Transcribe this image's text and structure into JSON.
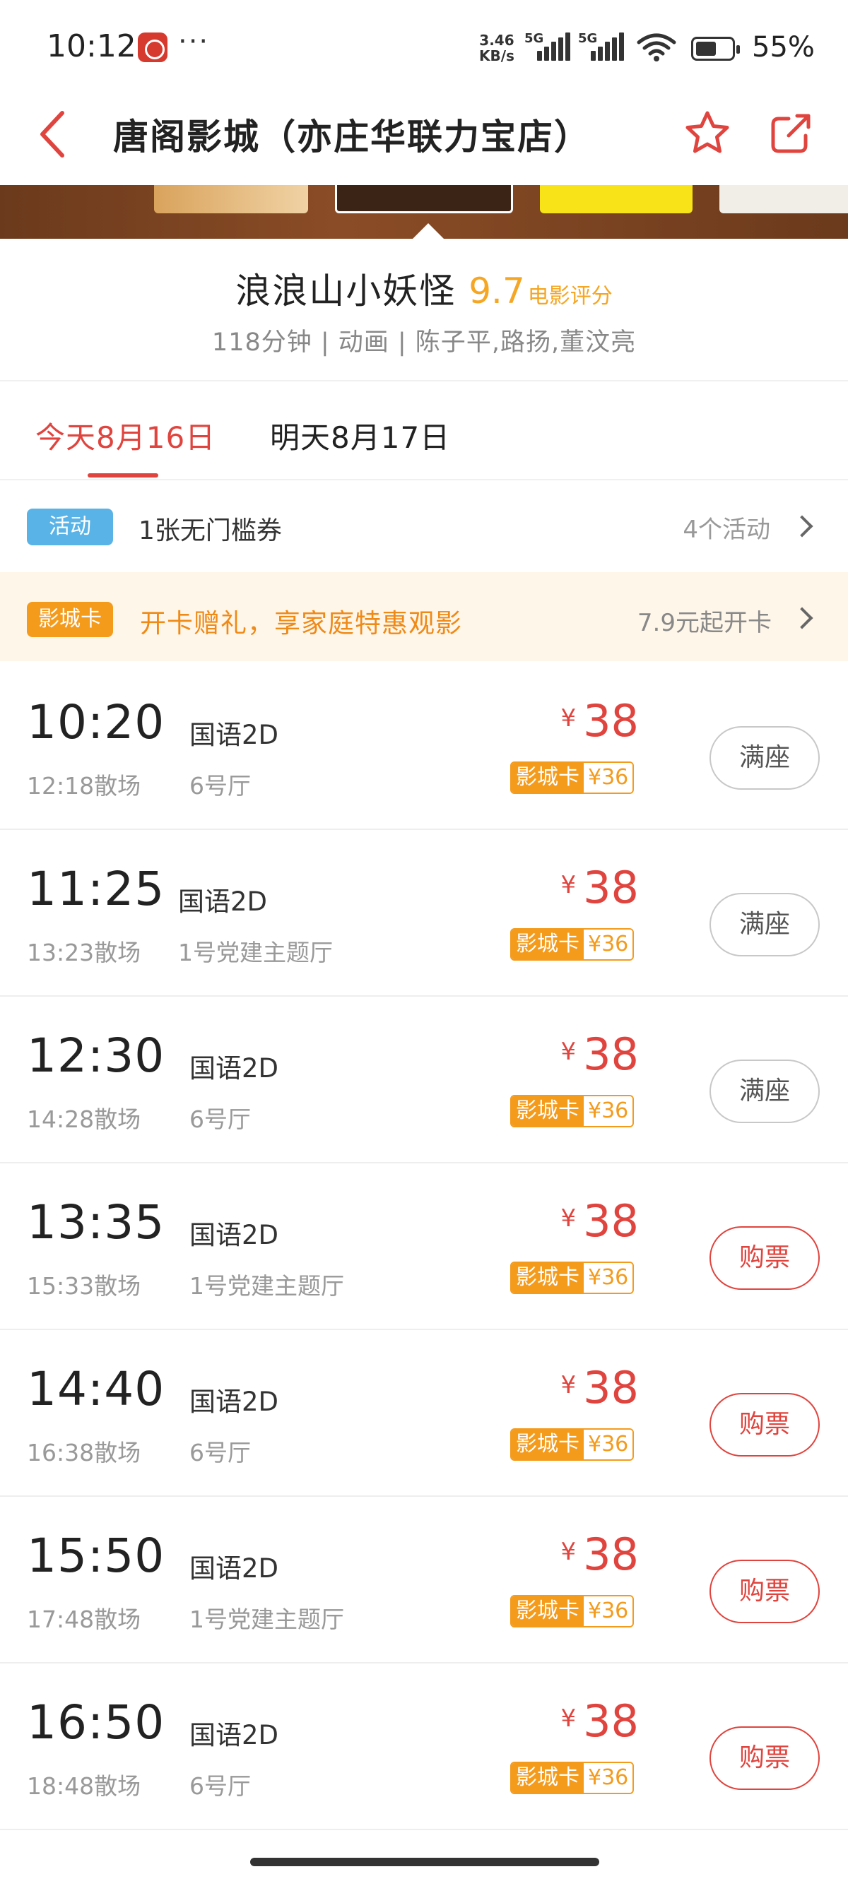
{
  "status_bar": {
    "time": "10:12",
    "dots": "···",
    "net_speed_value": "3.46",
    "net_speed_unit": "KB/s",
    "network_1": "5G",
    "network_2": "5G",
    "battery": "55%"
  },
  "header": {
    "title": "唐阁影城（亦庄华联力宝店）"
  },
  "movie": {
    "name": "浪浪山小妖怪",
    "score": "9.7",
    "score_label": "电影评分",
    "meta": "118分钟 | 动画 | 陈子平,路扬,董汶亮"
  },
  "date_tabs": [
    {
      "label": "今天8月16日",
      "active": true
    },
    {
      "label": "明天8月17日",
      "active": false
    }
  ],
  "activity": {
    "badge": "活动",
    "text": "1张无门槛券",
    "count": "4个活动"
  },
  "cinema_card": {
    "badge": "影城卡",
    "text": "开卡赠礼，享家庭特惠观影",
    "price": "7.9元起开卡"
  },
  "currency": "¥",
  "card_tag_label": "影城卡",
  "showtimes": [
    {
      "start": "10:20",
      "end": "12:18散场",
      "lang": "国语2D",
      "hall": "6号厅",
      "price": "38",
      "card_price": "¥36",
      "action": "满座",
      "status": "full"
    },
    {
      "start": "11:25",
      "end": "13:23散场",
      "lang": "国语2D",
      "hall": "1号党建主题厅",
      "price": "38",
      "card_price": "¥36",
      "action": "满座",
      "status": "full"
    },
    {
      "start": "12:30",
      "end": "14:28散场",
      "lang": "国语2D",
      "hall": "6号厅",
      "price": "38",
      "card_price": "¥36",
      "action": "满座",
      "status": "full"
    },
    {
      "start": "13:35",
      "end": "15:33散场",
      "lang": "国语2D",
      "hall": "1号党建主题厅",
      "price": "38",
      "card_price": "¥36",
      "action": "购票",
      "status": "buy"
    },
    {
      "start": "14:40",
      "end": "16:38散场",
      "lang": "国语2D",
      "hall": "6号厅",
      "price": "38",
      "card_price": "¥36",
      "action": "购票",
      "status": "buy"
    },
    {
      "start": "15:50",
      "end": "17:48散场",
      "lang": "国语2D",
      "hall": "1号党建主题厅",
      "price": "38",
      "card_price": "¥36",
      "action": "购票",
      "status": "buy"
    },
    {
      "start": "16:50",
      "end": "18:48散场",
      "lang": "国语2D",
      "hall": "6号厅",
      "price": "38",
      "card_price": "¥36",
      "action": "购票",
      "status": "buy"
    }
  ],
  "colors": {
    "accent_red": "#e0443e",
    "score_orange": "#f5a623",
    "card_orange": "#f49b1c",
    "activity_blue": "#5ab3e6"
  },
  "icons": [
    "back-arrow-icon",
    "star-icon",
    "share-icon",
    "chevron-right-icon",
    "wifi-icon",
    "battery-icon",
    "signal-icon"
  ]
}
